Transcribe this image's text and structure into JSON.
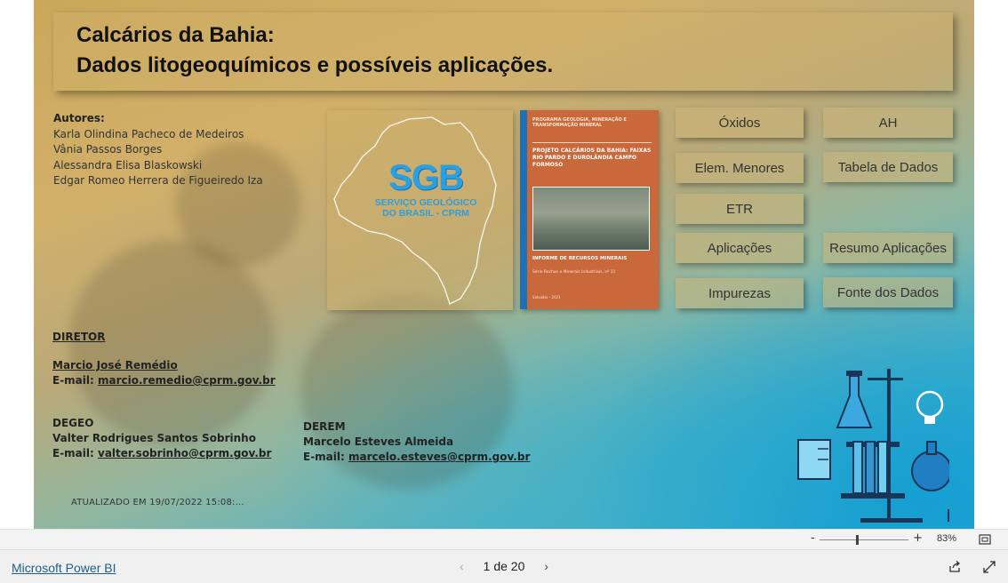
{
  "report": {
    "title_line1": "Calcários da Bahia:",
    "title_line2": "Dados litogeoquímicos e possíveis aplicações.",
    "authors_heading": "Autores:",
    "authors": [
      "Karla Olindina Pacheco de Medeiros",
      "Vânia Passos Borges",
      "Alessandra Elisa Blaskowski",
      "Edgar Romeo Herrera de Figueiredo Iza"
    ],
    "logo": {
      "name": "SGB",
      "line1": "SERVIÇO GEOLÓGICO",
      "line2": "DO BRASIL - CPRM"
    },
    "book": {
      "header": "PROGRAMA GEOLOGIA, MINERAÇÃO E TRANSFORMAÇÃO MINERAL",
      "title": "PROJETO CALCÁRIOS DA BAHIA: FAIXAS RIO PARDO E DUROLÂNDIA CAMPO FORMOSO",
      "series": "INFORME DE RECURSOS MINERAIS",
      "subseries": "Série Rochas e Minerais Industriais, nº 31",
      "place_year": "Salvador - 2021"
    },
    "buttons": {
      "oxidos": "Óxidos",
      "ah": "AH",
      "elem_menores": "Elem. Menores",
      "tabela_dados": "Tabela de Dados",
      "etr": "ETR",
      "aplicacoes": "Aplicações",
      "resumo_aplicacoes": "Resumo Aplicações",
      "impurezas": "Impurezas",
      "fonte_dados": "Fonte dos Dados"
    },
    "diretor": {
      "heading": "DIRETOR",
      "name": "Marcio José Remédio",
      "email_label": "E-mail:",
      "email": "marcio.remedio@cprm.gov.br"
    },
    "degeo": {
      "heading": "DEGEO",
      "name": "Valter Rodrigues Santos Sobrinho",
      "email_label": "E-mail:",
      "email": "valter.sobrinho@cprm.gov.br"
    },
    "derem": {
      "heading": "DEREM",
      "name": "Marcelo Esteves Almeida",
      "email_label": "E-mail:",
      "email": "marcelo.esteves@cprm.gov.br"
    },
    "updated": "ATUALIZADO EM 19/07/2022 15:08:..."
  },
  "zoom": {
    "minus": "-",
    "plus": "+",
    "level": "83%",
    "level_fraction": 0.83
  },
  "footer": {
    "brand": "Microsoft Power BI",
    "page_indicator": "1 de 20",
    "prev": "‹",
    "next": "›",
    "share_icon": "share-icon",
    "expand_icon": "expand-icon"
  }
}
